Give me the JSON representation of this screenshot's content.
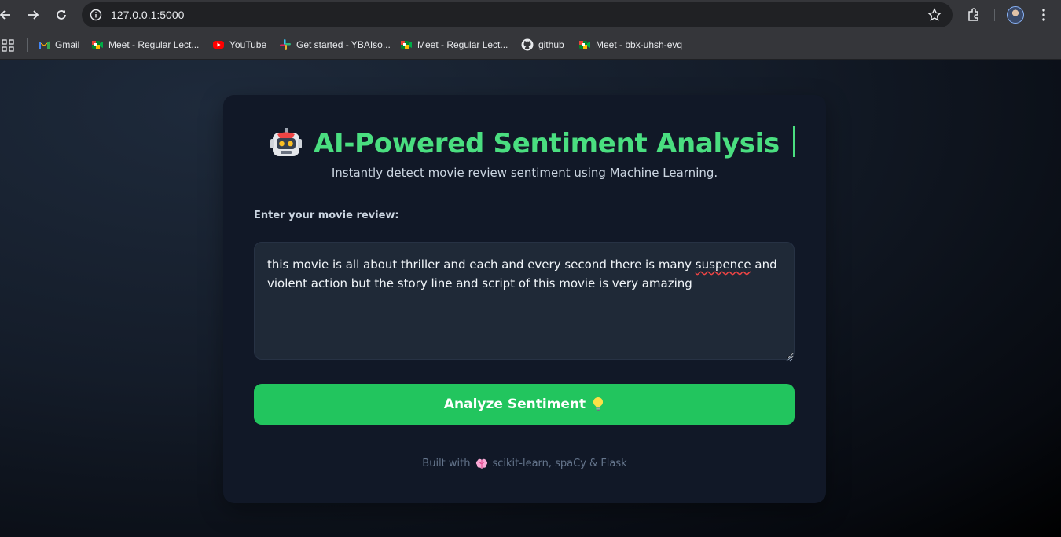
{
  "browser": {
    "url": "127.0.0.1:5000",
    "bookmarks": [
      {
        "label": "Gmail",
        "icon": "gmail-icon"
      },
      {
        "label": "Meet - Regular Lect...",
        "icon": "meet-icon"
      },
      {
        "label": "YouTube",
        "icon": "youtube-icon"
      },
      {
        "label": "Get started - YBAIso...",
        "icon": "slack-icon"
      },
      {
        "label": "Meet - Regular Lect...",
        "icon": "meet-icon"
      },
      {
        "label": "github",
        "icon": "github-icon"
      },
      {
        "label": "Meet - bbx-uhsh-evq",
        "icon": "meet-icon"
      }
    ]
  },
  "app": {
    "title": "AI-Powered Sentiment Analysis",
    "subtitle": "Instantly detect movie review sentiment using Machine Learning.",
    "review_label": "Enter your movie review:",
    "review_text_before": "this movie is all about thriller and each and every second  there is many ",
    "review_text_misspelled": "suspence",
    "review_text_after": " and violent action but the story line and script of this movie is very amazing",
    "button_label": "Analyze Sentiment",
    "footer_prefix": "Built with",
    "footer_suffix": "scikit-learn, spaCy & Flask",
    "colors": {
      "accent": "#4ade80",
      "button": "#22c55e",
      "card": "#111827",
      "input": "#1f2937"
    }
  }
}
